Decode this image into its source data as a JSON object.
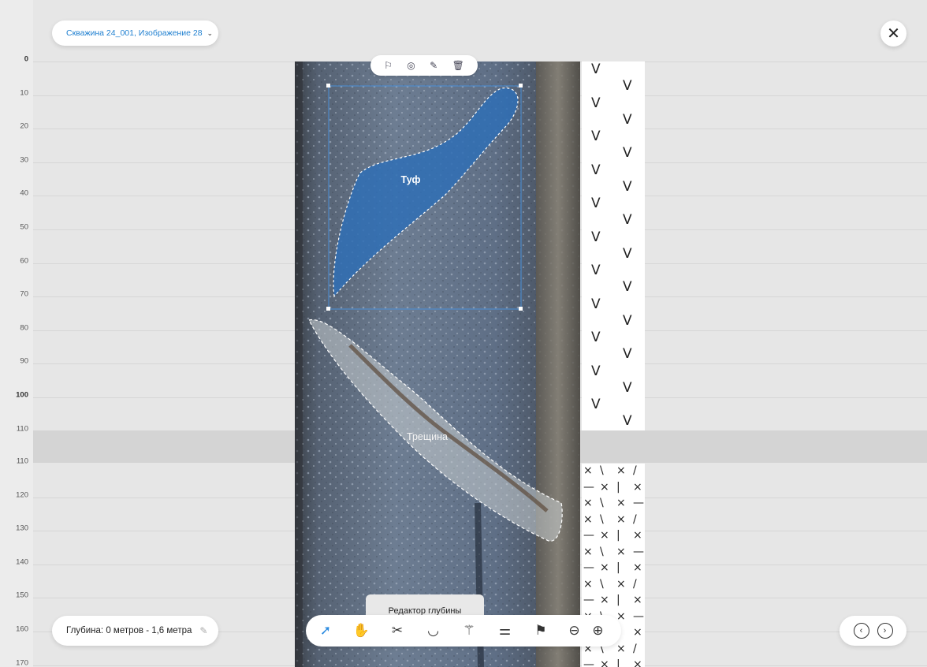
{
  "header": {
    "image_selector": "Скважина 24_001, Изображение 28",
    "chevron_icon": "chevron-down-icon",
    "close_icon": "close-icon"
  },
  "ruler": {
    "top_ticks": [
      "0",
      "10",
      "20",
      "30",
      "40",
      "50",
      "60",
      "70",
      "80",
      "90",
      "100",
      "110"
    ],
    "bottom_ticks": [
      "110",
      "120",
      "130",
      "140",
      "150",
      "160",
      "170"
    ]
  },
  "regions": {
    "tuff_label": "Туф",
    "crack_label": "Трещина"
  },
  "selection_toolbar": {
    "icons": [
      "flag-icon",
      "eye-off-icon",
      "pencil-icon",
      "trash-icon"
    ]
  },
  "depth": {
    "label": "Глубина: 0 метров - 1,6 метра",
    "edit_icon": "pencil-icon"
  },
  "tooltip": {
    "text": "Редактор глубины"
  },
  "toolbar": {
    "tools": [
      "select-arrow-icon",
      "hand-icon",
      "scissors-icon",
      "lasso-icon",
      "magic-wand-icon",
      "sliders-icon",
      "flag-icon",
      "zoom-out-icon",
      "zoom-in-icon"
    ],
    "active_tool": "select-arrow-icon"
  },
  "navigation": {
    "prev_icon": "chevron-left-icon",
    "next_icon": "chevron-right-icon"
  },
  "log_column": {
    "top_symbol": "V",
    "bottom_symbols": [
      "×",
      "\\",
      "|",
      "/",
      "—"
    ]
  },
  "colors": {
    "accent": "#2a8ae0",
    "tuff_fill": "#2f6fb5",
    "selection_outline": "#4a90d9"
  }
}
